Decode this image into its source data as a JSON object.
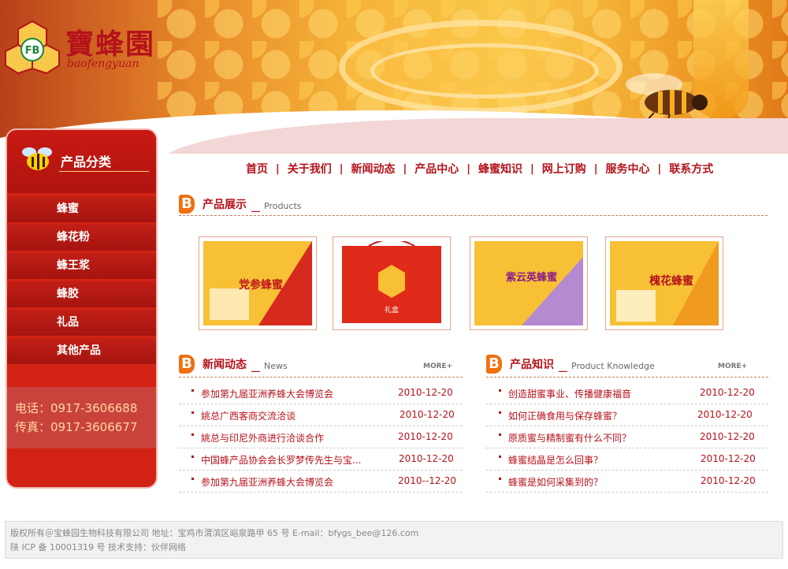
{
  "logo": {
    "name": "寶蜂園",
    "sub": "baofengyuan",
    "badge": "FB"
  },
  "nav": [
    "首页",
    "关于我们",
    "新闻动态",
    "产品中心",
    "蜂蜜知识",
    "网上订购",
    "服务中心",
    "联系方式"
  ],
  "sidebar": {
    "title": "产品分类",
    "items": [
      "蜂蜜",
      "蜂花粉",
      "蜂王浆",
      "蜂胶",
      "礼品",
      "其他产品"
    ],
    "phone": "电话：0917-3606688",
    "fax": "传真：0917-3606677"
  },
  "products_section": {
    "b": "B",
    "title": "产品展示",
    "dash": "__",
    "en": "Products",
    "items": [
      {
        "label": "党参蜂蜜"
      },
      {
        "label": "礼盒"
      },
      {
        "label": "紫云英蜂蜜"
      },
      {
        "label": "槐花蜂蜜"
      }
    ]
  },
  "news": {
    "b": "B",
    "title": "新闻动态",
    "dash": "__",
    "en": "News",
    "more": "MORE+",
    "rows": [
      {
        "title": "参加第九届亚洲养蜂大会博览会",
        "date": "2010-12-20"
      },
      {
        "title": "姚总广西客商交流洽谈",
        "date": "2010-12-20"
      },
      {
        "title": "姚总与印尼外商进行洽谈合作",
        "date": "2010-12-20"
      },
      {
        "title": "中国蜂产品协会会长罗梦传先生与宝...",
        "date": "2010-12-20"
      },
      {
        "title": "参加第九届亚洲养蜂大会博览会",
        "date": "2010--12-20"
      }
    ]
  },
  "knowledge": {
    "b": "B",
    "title": "产品知识",
    "dash": "__",
    "en": "Product Knowledge",
    "more": "MORE+",
    "rows": [
      {
        "title": "创造甜蜜事业、传播健康福音",
        "date": "2010-12-20"
      },
      {
        "title": "如何正确食用与保存蜂蜜？",
        "date": "2010-12-20"
      },
      {
        "title": "原质蜜与精制蜜有什么不同？",
        "date": "2010-12-20"
      },
      {
        "title": "蜂蜜结晶是怎么回事？",
        "date": "2010-12-20"
      },
      {
        "title": "蜂蜜是如何采集到的？",
        "date": "2010-12-20"
      }
    ]
  },
  "footer": {
    "line1": "版权所有＠宝蜂园生物科技有限公司    地址：宝鸡市渭滨区峪泉路甲 65 号    E-mail：bfygs_bee@126.com",
    "line2": "陕 ICP 备 10001319 号    技术支持：伙伴网络"
  },
  "colors": {
    "brand_red": "#b5121b",
    "sidebar_red": "#d22214",
    "honey": "#f5b338"
  }
}
